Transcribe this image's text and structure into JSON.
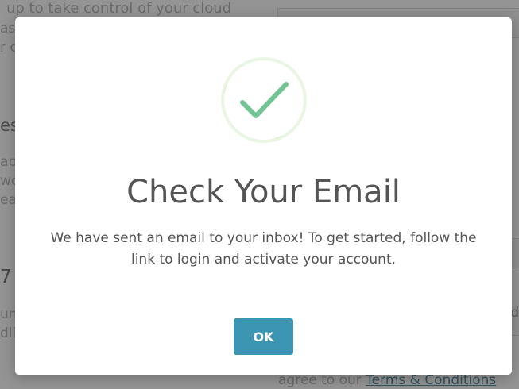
{
  "background": {
    "lines": [
      "up to take control of your cloud",
      "ast",
      "r cl",
      "es",
      "apu",
      "wor",
      "eas",
      "7",
      "und",
      "dli"
    ],
    "right_partial": "d",
    "terms_prefix": "agree to our ",
    "terms_link": "Terms & Conditions"
  },
  "modal": {
    "icon": "success-checkmark-icon",
    "title": "Check Your Email",
    "message": "We have sent an email to your inbox! To get started, follow the link to login and activate your account.",
    "ok_label": "OK"
  },
  "colors": {
    "button": "#3d95b4",
    "check": "#73c493",
    "ring": "#eaf6e4",
    "text": "#555555"
  }
}
